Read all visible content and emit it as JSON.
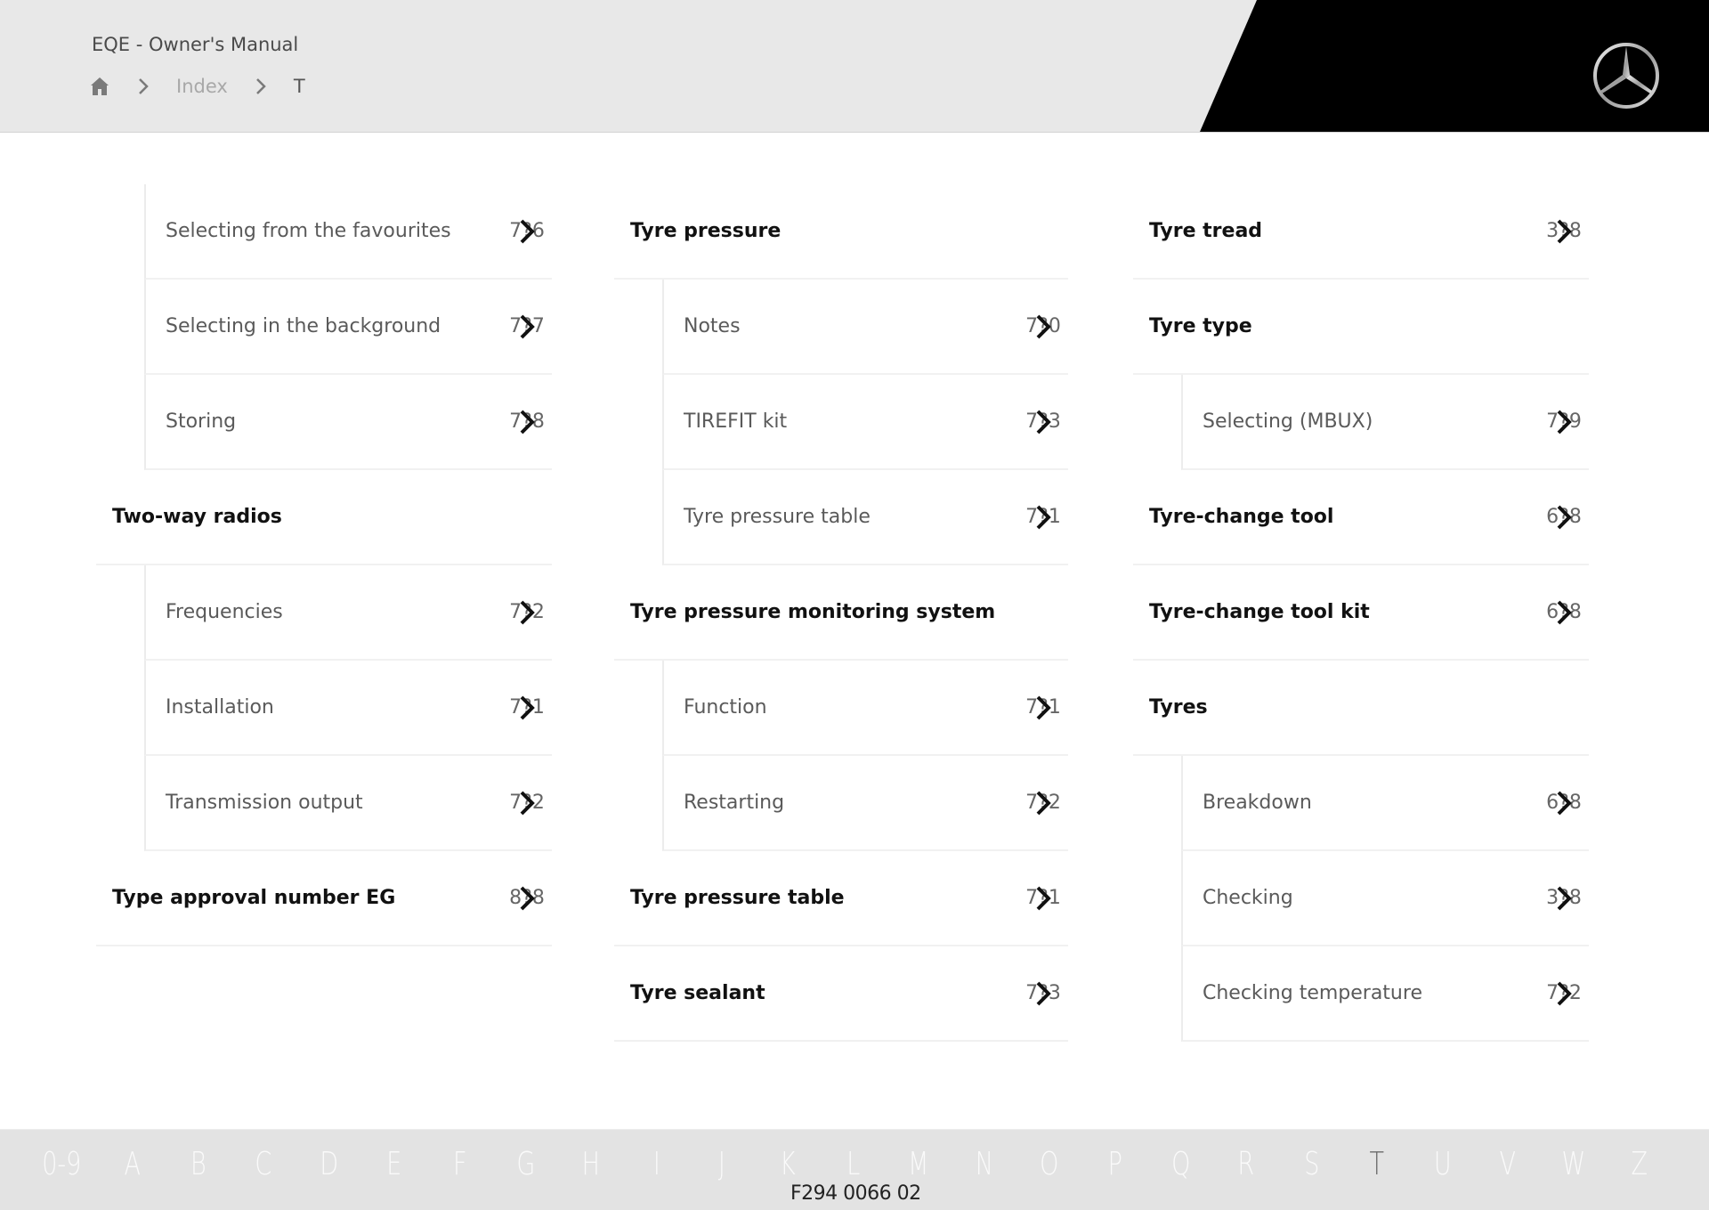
{
  "header": {
    "title": "EQE - Owner's Manual",
    "breadcrumb": [
      {
        "label": "Home",
        "icon": "home-icon"
      },
      {
        "label": "Index"
      },
      {
        "label": "T"
      }
    ]
  },
  "columns": [
    {
      "rows": [
        {
          "type": "sub",
          "label": "Selecting from the favourites",
          "page": "7?6"
        },
        {
          "type": "sub",
          "label": "Selecting in the background",
          "page": "7?7"
        },
        {
          "type": "sub",
          "label": "Storing",
          "page": "7?8"
        },
        {
          "type": "heading",
          "label": "Two-way radios",
          "page": ""
        },
        {
          "type": "sub",
          "label": "Frequencies",
          "page": "7?2"
        },
        {
          "type": "sub",
          "label": "Installation",
          "page": "7?1"
        },
        {
          "type": "sub",
          "label": "Transmission output",
          "page": "7?2"
        },
        {
          "type": "heading",
          "label": "Type approval number EG",
          "page": "8?8"
        }
      ]
    },
    {
      "rows": [
        {
          "type": "heading",
          "label": "Tyre pressure",
          "page": ""
        },
        {
          "type": "sub",
          "label": "Notes",
          "page": "7?0"
        },
        {
          "type": "sub",
          "label": "TIREFIT kit",
          "page": "7?3"
        },
        {
          "type": "sub",
          "label": "Tyre pressure table",
          "page": "7?1"
        },
        {
          "type": "heading",
          "label": "Tyre pressure monitoring system",
          "page": ""
        },
        {
          "type": "sub",
          "label": "Function",
          "page": "7?1"
        },
        {
          "type": "sub",
          "label": "Restarting",
          "page": "7?2"
        },
        {
          "type": "heading",
          "label": "Tyre pressure table",
          "page": "7?1"
        },
        {
          "type": "heading",
          "label": "Tyre sealant",
          "page": "7?3"
        }
      ]
    },
    {
      "rows": [
        {
          "type": "heading",
          "label": "Tyre tread",
          "page": "3?8"
        },
        {
          "type": "heading",
          "label": "Tyre type",
          "page": ""
        },
        {
          "type": "sub",
          "label": "Selecting (MBUX)",
          "page": "7?9"
        },
        {
          "type": "heading",
          "label": "Tyre-change tool",
          "page": "6?8"
        },
        {
          "type": "heading",
          "label": "Tyre-change tool kit",
          "page": "6?8"
        },
        {
          "type": "heading",
          "label": "Tyres",
          "page": ""
        },
        {
          "type": "sub",
          "label": "Breakdown",
          "page": "6?8"
        },
        {
          "type": "sub",
          "label": "Checking",
          "page": "3?8"
        },
        {
          "type": "sub",
          "label": "Checking temperature",
          "page": "7?2"
        }
      ]
    }
  ],
  "alphabet": {
    "letters": [
      "0-9",
      "A",
      "B",
      "C",
      "D",
      "E",
      "F",
      "G",
      "H",
      "I",
      "J",
      "K",
      "L",
      "M",
      "N",
      "O",
      "P",
      "Q",
      "R",
      "S",
      "T",
      "U",
      "V",
      "W",
      "Z"
    ],
    "active": "T"
  },
  "footer": {
    "doc_code": "F294 0066 02"
  },
  "colors": {
    "header_bg": "#e8e8e8",
    "header_black": "#000000",
    "alpha_bar_bg": "#e3e3e3",
    "alpha_active": "#6a6a6a"
  }
}
